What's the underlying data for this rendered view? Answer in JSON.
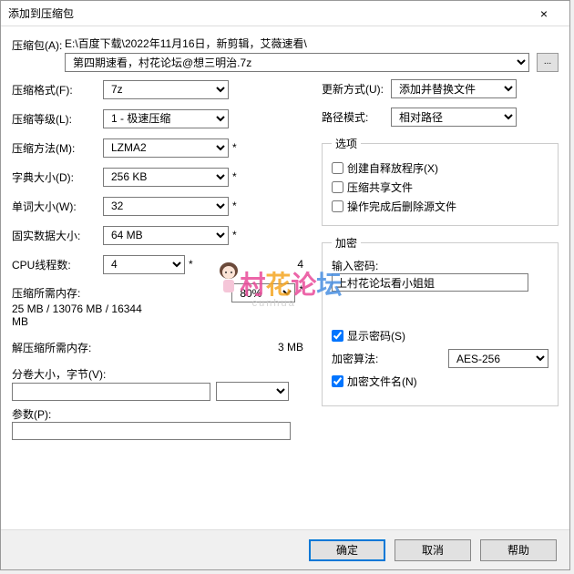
{
  "title": "添加到压缩包",
  "close": "×",
  "archive": {
    "label": "压缩包(A):",
    "path": "E:\\百度下载\\2022年11月16日，新剪辑，艾薇速看\\",
    "filename": "第四期速看，村花论坛@想三明治.7z",
    "browse": "..."
  },
  "left": {
    "format_label": "压缩格式(F):",
    "format_value": "7z",
    "level_label": "压缩等级(L):",
    "level_value": "1 - 极速压缩",
    "method_label": "压缩方法(M):",
    "method_value": "LZMA2",
    "dict_label": "字典大小(D):",
    "dict_value": "256 KB",
    "word_label": "单词大小(W):",
    "word_value": "32",
    "solid_label": "固实数据大小:",
    "solid_value": "64 MB",
    "cpu_label": "CPU线程数:",
    "cpu_value": "4",
    "cpu_max": "4",
    "mem_compress_label": "压缩所需内存:",
    "mem_compress_value": "25 MB / 13076 MB / 16344 MB",
    "mem_percent": "80%",
    "mem_decompress_label": "解压缩所需内存:",
    "mem_decompress_value": "3 MB",
    "split_label": "分卷大小，字节(V):",
    "split_value": "",
    "param_label": "参数(P):",
    "param_value": ""
  },
  "right": {
    "update_label": "更新方式(U):",
    "update_value": "添加并替换文件",
    "path_mode_label": "路径模式:",
    "path_mode_value": "相对路径",
    "options_legend": "选项",
    "opt_sfx": "创建自释放程序(X)",
    "opt_share": "压缩共享文件",
    "opt_delete": "操作完成后删除源文件",
    "enc_legend": "加密",
    "pwd_label": "输入密码:",
    "pwd_value": "上村花论坛看小姐姐",
    "show_pwd": "显示密码(S)",
    "algo_label": "加密算法:",
    "algo_value": "AES-256",
    "enc_names": "加密文件名(N)"
  },
  "buttons": {
    "ok": "确定",
    "cancel": "取消",
    "help": "帮助"
  },
  "watermark": {
    "c1": "村",
    "c2": "花",
    "c3": "论",
    "c4": "坛",
    "sub": "cunhua"
  }
}
